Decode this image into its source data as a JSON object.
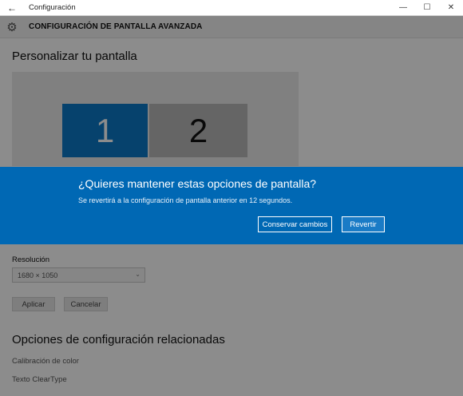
{
  "window": {
    "title": "Configuración",
    "back_icon": "←",
    "minimize_icon": "—",
    "maximize_icon": "☐",
    "close_icon": "✕"
  },
  "header": {
    "icon": "⚙",
    "title": "CONFIGURACIÓN DE PANTALLA AVANZADA"
  },
  "customize": {
    "title": "Personalizar tu pantalla",
    "monitors": [
      {
        "label": "1",
        "color": "#0b79c7"
      },
      {
        "label": "2",
        "color": "#b8b8b8"
      }
    ]
  },
  "resolution": {
    "label": "Resolución",
    "value": "1680 × 1050",
    "chevron": "⌄"
  },
  "actions": {
    "apply": "Aplicar",
    "cancel": "Cancelar"
  },
  "related": {
    "title": "Opciones de configuración relacionadas",
    "links": [
      "Calibración de color",
      "Texto ClearType"
    ]
  },
  "dialog": {
    "title": "¿Quieres mantener estas opciones de pantalla?",
    "message": "Se revertirá a la configuración de pantalla anterior en 12 segundos.",
    "keep_button": "Conservar cambios",
    "revert_button": "Revertir",
    "background_color": "#0068b4"
  }
}
